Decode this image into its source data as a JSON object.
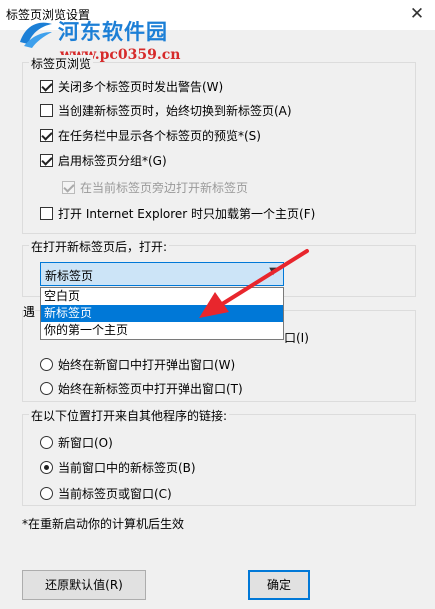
{
  "window": {
    "title": "标签页浏览设置",
    "close_glyph": "✕"
  },
  "watermark": {
    "site_name": "河东软件园",
    "url": "www.pc0359.cn"
  },
  "tab_browsing": {
    "group_label": "标签页浏览",
    "options": [
      {
        "label": "关闭多个标签页时发出警告(W)",
        "checked": true,
        "enabled": true
      },
      {
        "label": "当创建新标签页时，始终切换到新标签页(A)",
        "checked": false,
        "enabled": true
      },
      {
        "label": "在任务栏中显示各个标签页的预览*(S)",
        "checked": true,
        "enabled": true
      },
      {
        "label": "启用标签页分组*(G)",
        "checked": true,
        "enabled": true
      },
      {
        "label": "在当前标签页旁边打开新标签页",
        "checked": true,
        "enabled": false
      },
      {
        "label": "打开 Internet Explorer 时只加载第一个主页(F)",
        "checked": false,
        "enabled": true
      }
    ]
  },
  "new_tab": {
    "group_label": "在打开新标签页后，打开:",
    "selected_value": "新标签页",
    "dropdown_options": [
      {
        "label": "空白页",
        "highlighted": false
      },
      {
        "label": "新标签页",
        "highlighted": true
      },
      {
        "label": "你的第一个主页",
        "highlighted": false
      }
    ]
  },
  "popups": {
    "group_label_visible": "遇",
    "first_option_suffix": "口(I)",
    "options": [
      {
        "label": "始终在新窗口中打开弹出窗口(W)",
        "checked": false
      },
      {
        "label": "始终在新标签页中打开弹出窗口(T)",
        "checked": false
      }
    ]
  },
  "external_links": {
    "group_label": "在以下位置打开来自其他程序的链接:",
    "options": [
      {
        "label": "新窗口(O)",
        "checked": false
      },
      {
        "label": "当前窗口中的新标签页(B)",
        "checked": true
      },
      {
        "label": "当前标签页或窗口(C)",
        "checked": false
      }
    ]
  },
  "footnote": "*在重新启动你的计算机后生效",
  "buttons": {
    "restore_defaults": "还原默认值(R)",
    "ok_partial": "确定"
  },
  "colors": {
    "accent": "#0078d7",
    "select_bg": "#cce4f7",
    "annotation_arrow": "#e8262d",
    "watermark_blue": "#1c7fd6",
    "watermark_red": "#d62a2a"
  }
}
